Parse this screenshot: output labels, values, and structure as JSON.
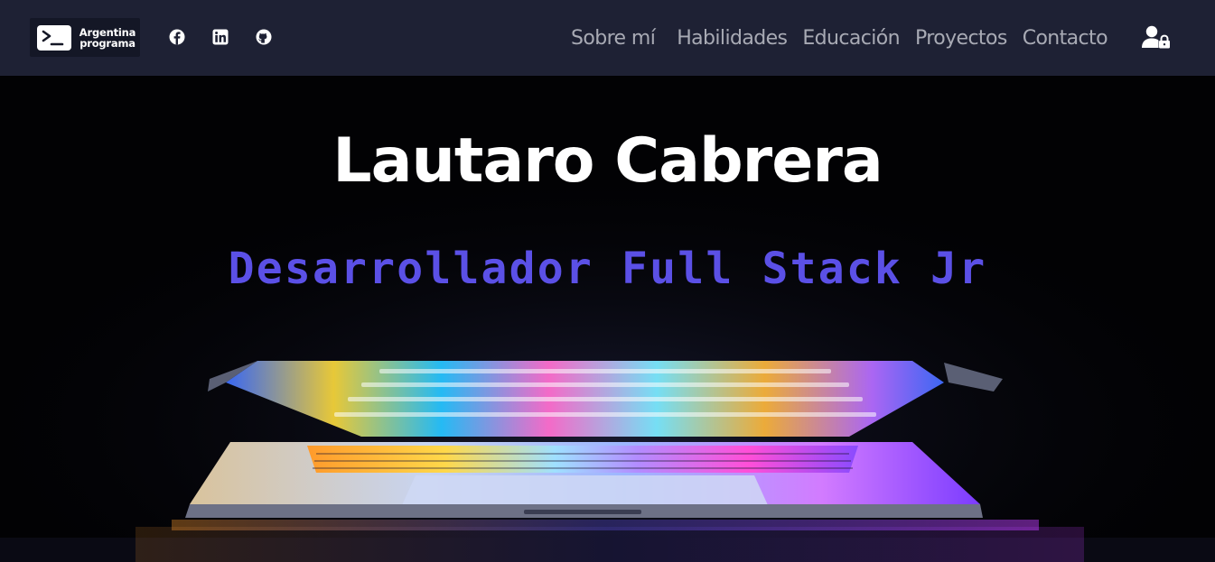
{
  "brand": {
    "line1": "Argentina",
    "line2": "programa",
    "icon": "terminal-prompt-icon"
  },
  "social": [
    {
      "name": "Facebook",
      "icon": "facebook-icon"
    },
    {
      "name": "LinkedIn",
      "icon": "linkedin-icon"
    },
    {
      "name": "GitHub",
      "icon": "github-icon"
    }
  ],
  "nav": {
    "links": [
      "Sobre mí",
      "Habilidades",
      "Educación",
      "Proyectos",
      "Contacto"
    ],
    "login_icon": "user-lock-icon"
  },
  "hero": {
    "title": "Lautaro Cabrera",
    "subtitle": "Desarrollador Full Stack Jr",
    "background": "laptop-rainbow-keyboard-photo"
  },
  "colors": {
    "navbar_bg": "#1e2134",
    "nav_link": "#a8aab4",
    "subtitle": "#5b50e6",
    "hero_bg": "#020204"
  }
}
